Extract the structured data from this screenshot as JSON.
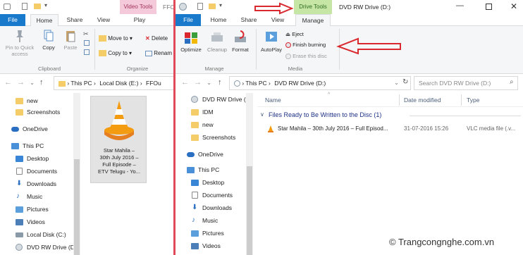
{
  "left_window": {
    "title_tab": "Video Tools",
    "title_partial": "FFC",
    "tabs": [
      "File",
      "Home",
      "Share",
      "View",
      "Play"
    ],
    "clipboard": {
      "pin_label": "Pin to Quick access",
      "copy_label": "Copy",
      "paste_label": "Paste",
      "group_label": "Clipboard"
    },
    "organize": {
      "move_to": "Move to",
      "copy_to": "Copy to",
      "delete": "Delete",
      "rename": "Renam",
      "group_label": "Organize"
    },
    "breadcrumb": [
      "This PC",
      "Local Disk (E:)",
      "FFOu"
    ],
    "nav": {
      "items": [
        {
          "label": "new",
          "icon": "folder-icon"
        },
        {
          "label": "Screenshots",
          "icon": "folder-icon"
        },
        {
          "label": "OneDrive",
          "icon": "cloud-icon"
        },
        {
          "label": "This PC",
          "icon": "computer-icon"
        },
        {
          "label": "Desktop",
          "icon": "desktop-icon"
        },
        {
          "label": "Documents",
          "icon": "documents-icon"
        },
        {
          "label": "Downloads",
          "icon": "downloads-icon"
        },
        {
          "label": "Music",
          "icon": "music-icon"
        },
        {
          "label": "Pictures",
          "icon": "pictures-icon"
        },
        {
          "label": "Videos",
          "icon": "videos-icon"
        },
        {
          "label": "Local Disk (C:)",
          "icon": "drive-icon"
        },
        {
          "label": "DVD RW Drive (D",
          "icon": "dvd-icon"
        }
      ]
    },
    "file_tile": {
      "lines": [
        "Star Mahila –",
        "30th July 2016 –",
        "Full Episode –",
        "ETV Telugu - Yo..."
      ]
    }
  },
  "right_window": {
    "title": "DVD RW Drive (D:)",
    "context_tab": "Drive Tools",
    "tabs": [
      "File",
      "Home",
      "Share",
      "View",
      "Manage"
    ],
    "ribbon": {
      "optimize": "Optimize",
      "cleanup": "Cleanup",
      "format": "Format",
      "autoplay": "AutoPlay",
      "eject": "Eject",
      "finish_burning": "Finish burning",
      "erase": "Erase this disc",
      "group_manage": "Manage",
      "group_media": "Media"
    },
    "breadcrumb": [
      "This PC",
      "DVD RW Drive (D:)"
    ],
    "search_placeholder": "Search DVD RW Drive (D:)",
    "nav": {
      "items": [
        {
          "label": "DVD RW Drive (D",
          "icon": "dvd-icon"
        },
        {
          "label": "IDM",
          "icon": "folder-icon"
        },
        {
          "label": "new",
          "icon": "folder-icon"
        },
        {
          "label": "Screenshots",
          "icon": "folder-icon"
        },
        {
          "label": "OneDrive",
          "icon": "cloud-icon"
        },
        {
          "label": "This PC",
          "icon": "computer-icon"
        },
        {
          "label": "Desktop",
          "icon": "desktop-icon"
        },
        {
          "label": "Documents",
          "icon": "documents-icon"
        },
        {
          "label": "Downloads",
          "icon": "downloads-icon"
        },
        {
          "label": "Music",
          "icon": "music-icon"
        },
        {
          "label": "Pictures",
          "icon": "pictures-icon"
        },
        {
          "label": "Videos",
          "icon": "videos-icon"
        }
      ]
    },
    "columns": {
      "name": "Name",
      "date": "Date modified",
      "type": "Type"
    },
    "group_header": "Files Ready to Be Written to the Disc (1)",
    "row": {
      "name": "Star Mahila – 30th July 2016 – Full Episod...",
      "date": "31-07-2016 15:26",
      "type": "VLC media file (.v..."
    }
  },
  "watermark": "© Trangcongnghe.com.vn",
  "colors": {
    "accent_blue": "#1979ca",
    "video_tools_pink": "#f4c9d9",
    "drive_tools_green": "#c6e6a6",
    "annotation_red": "#d9282e",
    "folder_yellow": "#f4cd68"
  }
}
